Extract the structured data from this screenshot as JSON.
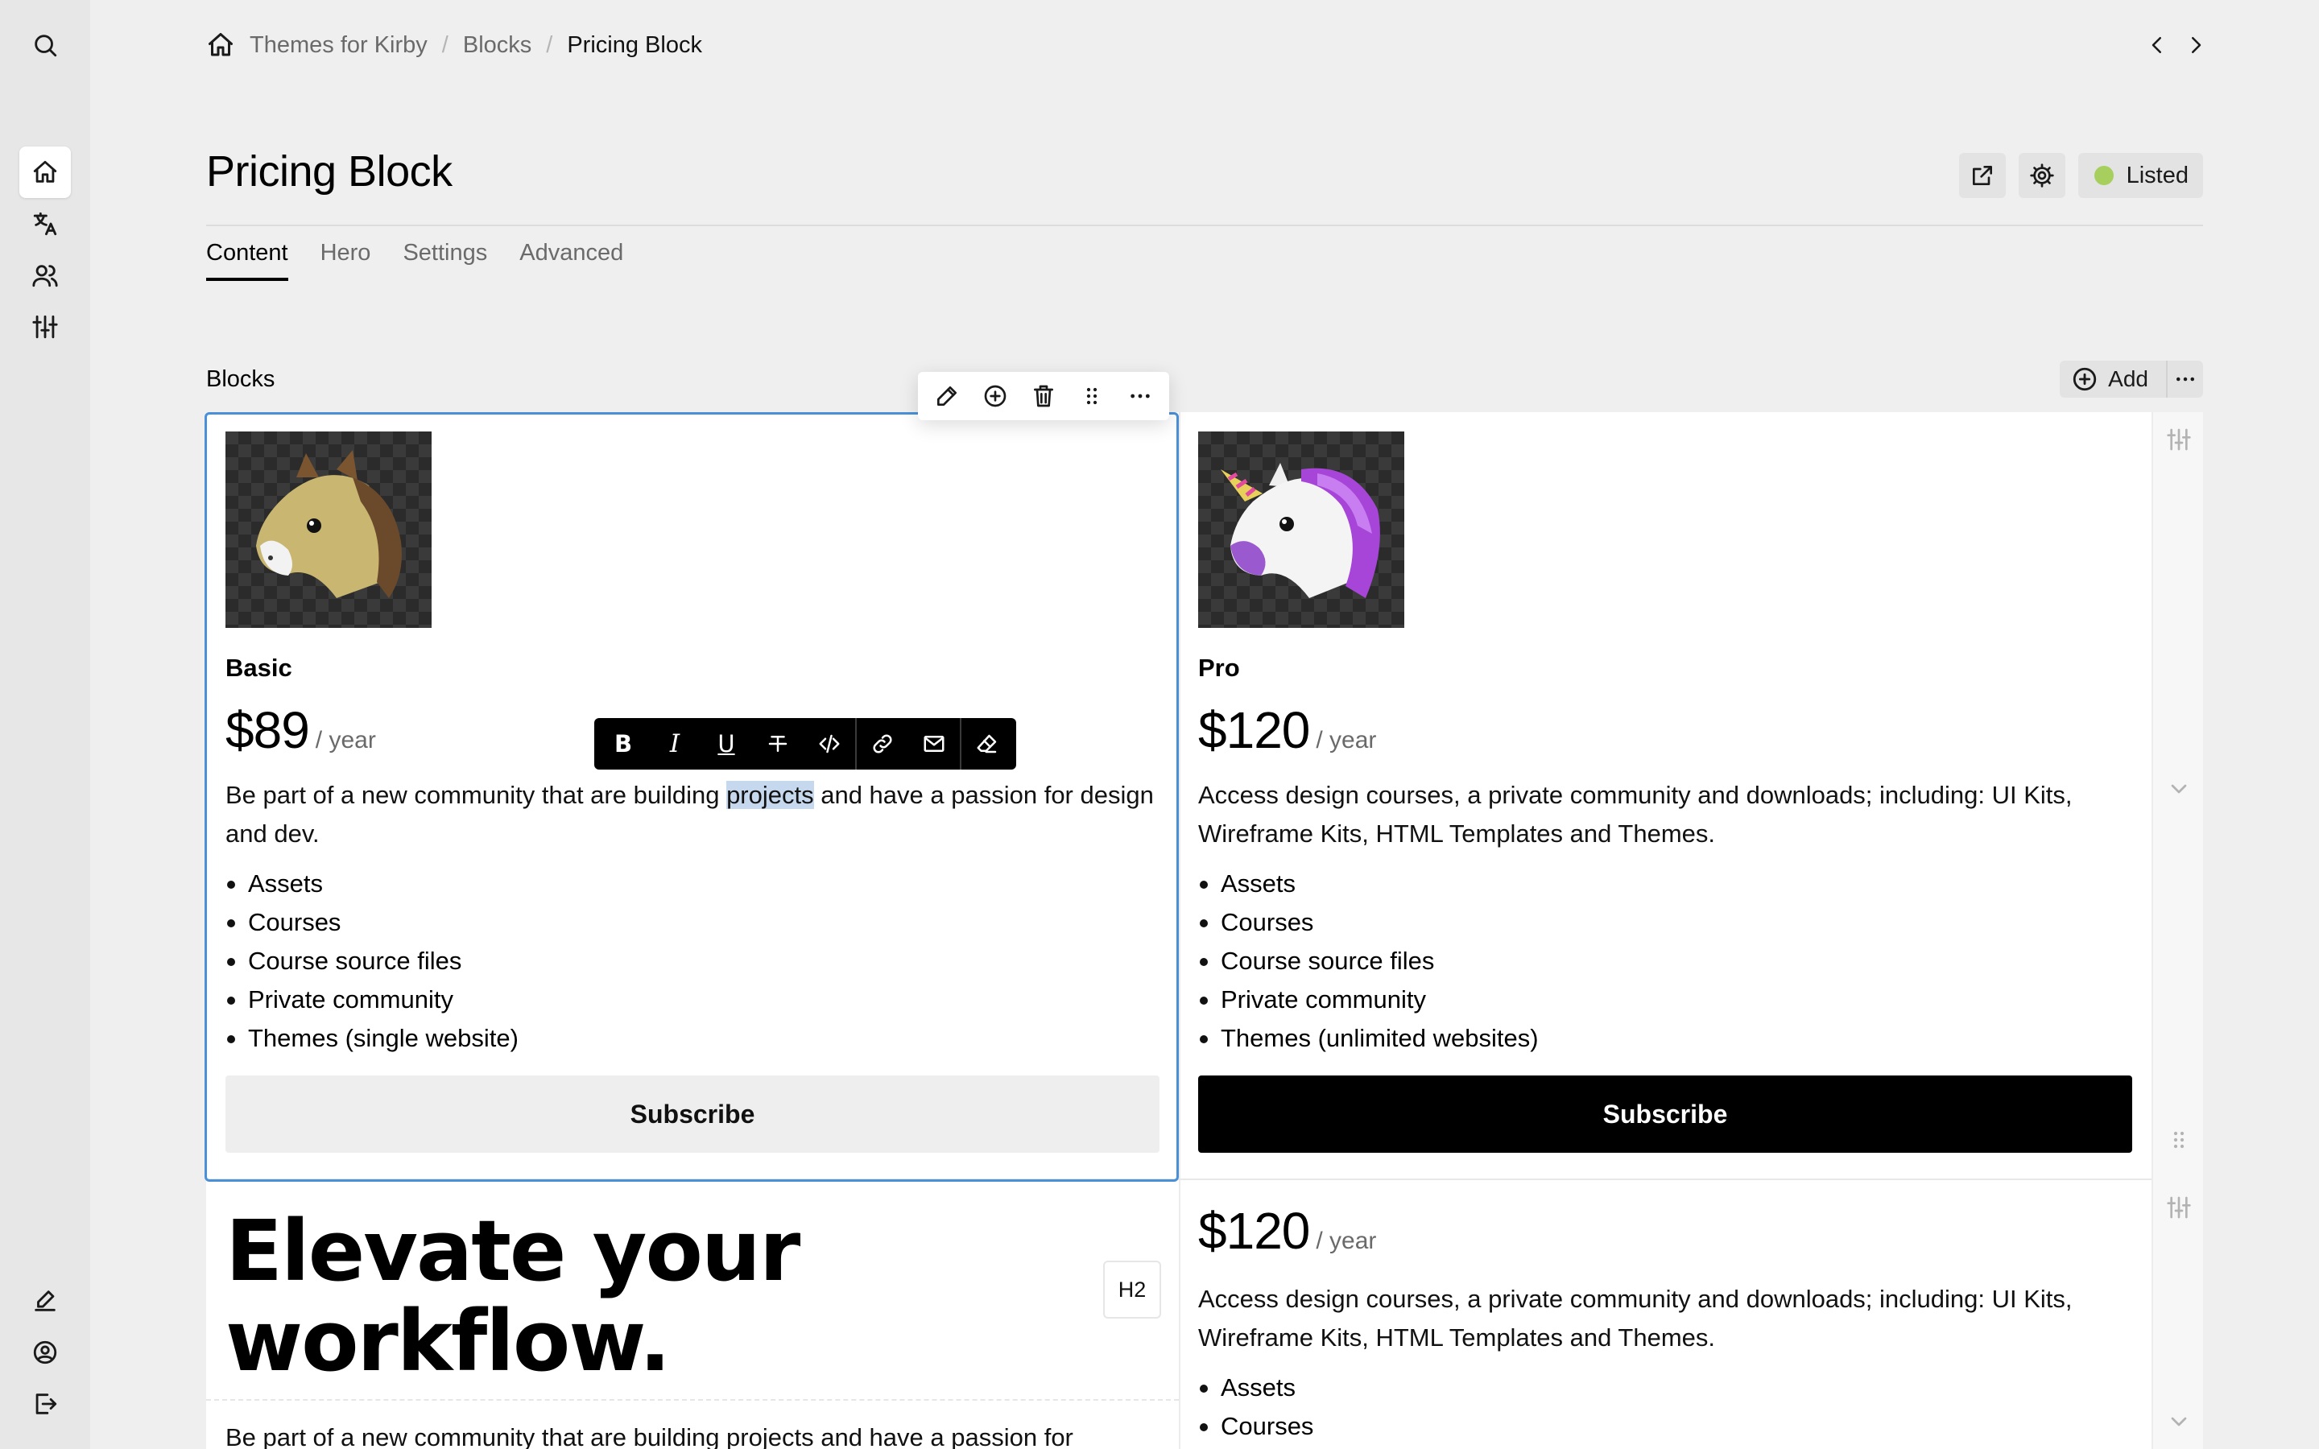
{
  "breadcrumb": {
    "home": "Themes for Kirby",
    "parent": "Blocks",
    "current": "Pricing Block"
  },
  "page": {
    "title": "Pricing Block",
    "status": "Listed",
    "status_color": "#a7cf5e"
  },
  "tabs": [
    "Content",
    "Hero",
    "Settings",
    "Advanced"
  ],
  "blocks_section": {
    "label": "Blocks",
    "add_label": "Add"
  },
  "cards": [
    {
      "name": "Basic",
      "price": "$89",
      "period": "/ year",
      "desc_before": "Be part of a new community that are building ",
      "desc_highlight": "projects",
      "desc_after": " and have a passion for design and dev.",
      "features": [
        "Assets",
        "Courses",
        "Course source files",
        "Private community",
        "Themes (single website)"
      ],
      "cta": "Subscribe",
      "image_icon": "horse-icon"
    },
    {
      "name": "Pro",
      "price": "$120",
      "period": "/ year",
      "desc": "Access design courses, a private community and downloads; including: UI Kits, Wireframe Kits, HTML Templates and Themes.",
      "features": [
        "Assets",
        "Courses",
        "Course source files",
        "Private community",
        "Themes (unlimited websites)"
      ],
      "cta": "Subscribe",
      "image_icon": "unicorn-icon"
    }
  ],
  "heading_block": {
    "text_line1": "Elevate your",
    "text_line2": "workflow.",
    "level": "H2"
  },
  "text_block": {
    "text": "Be part of a new community that are building projects and have a passion for"
  },
  "card3": {
    "price": "$120",
    "period": "/ year",
    "desc": "Access design courses, a private community and downloads; including: UI Kits, Wireframe Kits, HTML Templates and Themes.",
    "features": [
      "Assets",
      "Courses"
    ]
  },
  "colors": {
    "selection": "#4a90d9",
    "highlight": "#c6d8ee"
  }
}
